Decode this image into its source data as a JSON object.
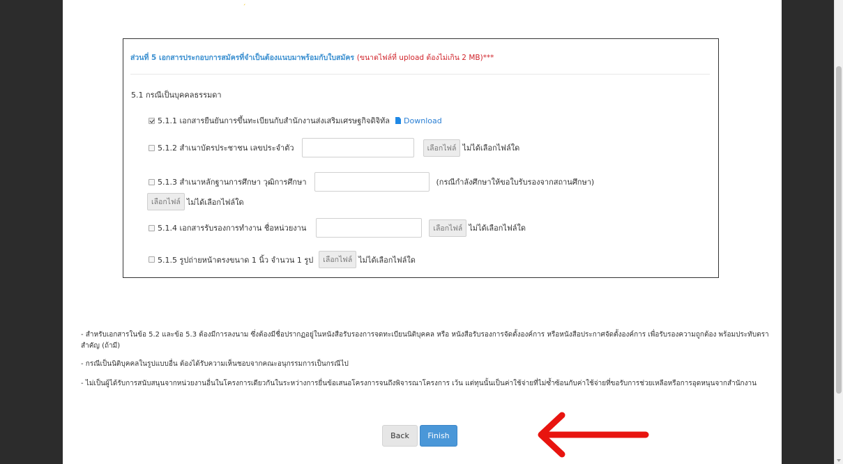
{
  "section": {
    "title": "ส่วนที่ 5 เอกสารประกอบการสมัครที่จำเป็นต้องแนบมาพร้อมกับใบสมัคร",
    "note": "(ขนาดไฟล์ที่ upload ต้องไม่เกิน 2 MB)***",
    "subhead": "5.1 กรณีเป็นบุคคลธรรมดา"
  },
  "items": [
    {
      "label": "5.1.1 เอกสารยืนยันการขึ้นทะเบียนกับสำนักงานส่งเสริมเศรษฐกิจดิจิทัล",
      "checked": true,
      "download": "Download"
    },
    {
      "label": "5.1.2 สำเนาบัตรประชาชน เลขประจำตัว",
      "checked": false
    },
    {
      "label": "5.1.3 สำเนาหลักฐานการศึกษา วุฒิการศึกษา",
      "checked": false,
      "hint": "(กรณีกำลังศึกษาให้ขอใบรับรองจากสถานศึกษา)"
    },
    {
      "label": "5.1.4 เอกสารรับรองการทำงาน ชื่อหน่วยงาน",
      "checked": false
    },
    {
      "label": "5.1.5 รูปถ่ายหน้าตรงขนาด 1 นิ้ว จำนวน 1 รูป",
      "checked": false
    }
  ],
  "file": {
    "button": "เลือกไฟล์",
    "status": "ไม่ได้เลือกไฟล์ใด"
  },
  "notes": [
    "-   สำหรับเอกสารในข้อ 5.2 และข้อ 5.3 ต้องมีการลงนาม ซึ่งต้องมีชื่อปรากฏอยู่ในหนังสือรับรองการจดทะเบียนนิติบุคคล หรือ หนังสือรับรองการจัดตั้งองค์การ หรือหนังสือประกาศจัดตั้งองค์การ เพื่อรับรองความถูกต้อง พร้อมประทับตราสำคัญ (ถ้ามี)",
    "-   กรณีเป็นนิติบุคคลในรูปแบบอื่น ต้องได้รับความเห็นชอบจากคณะอนุกรรมการเป็นกรณีไป",
    "-   ไม่เป็นผู้ได้รับการสนับสนุนจากหน่วยงานอื่นในโครงการเดียวกันในระหว่างการยื่นข้อเสนอโครงการจนถึงพิจารณาโครงการ เว้น แต่ทุนนั้นเป็นค่าใช้จ่ายที่ไม่ซ้ำซ้อนกับค่าใช้จ่ายที่ขอรับการช่วยเหลือหรือการอุดหนุนจากสำนักงาน"
  ],
  "buttons": {
    "back": "Back",
    "finish": "Finish"
  },
  "colors": {
    "accent": "#4a97d8",
    "title": "#3a8fd0",
    "warning": "#d0242b",
    "arrow": "#e8140f"
  }
}
